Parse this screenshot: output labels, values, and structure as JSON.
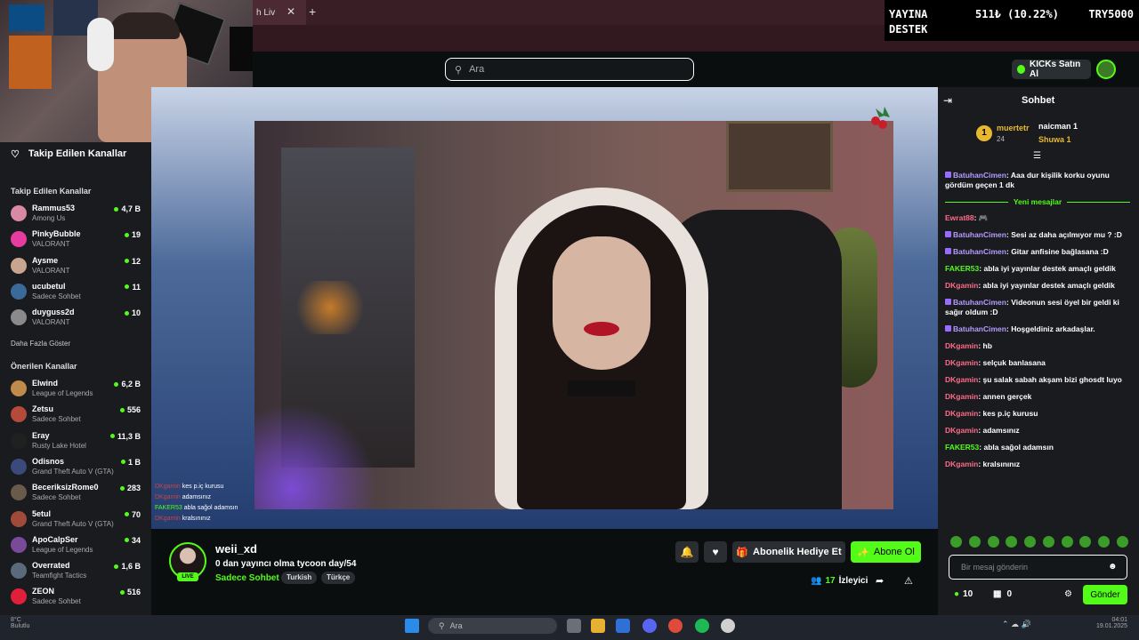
{
  "browser": {
    "tab_title": "h Liv",
    "tab_close": "✕",
    "new_tab": "+"
  },
  "donation_overlay": {
    "line1": "YAYINA",
    "line2": "DESTEK",
    "amount": "511₺ (10.22%)",
    "goal": "TRY5000"
  },
  "header": {
    "search_placeholder": "Ara",
    "kicks_button": "KICKs Satın Al"
  },
  "sidebar": {
    "heading": "Takip Edilen Kanallar",
    "followed_title": "Takip Edilen Kanallar",
    "followed": [
      {
        "name": "Rammus53",
        "category": "Among Us",
        "viewers": "4,7 B",
        "color": "#d88aa3"
      },
      {
        "name": "PinkyBubble",
        "category": "VALORANT",
        "viewers": "19",
        "color": "#e63ca0"
      },
      {
        "name": "Aysme",
        "category": "VALORANT",
        "viewers": "12",
        "color": "#c9a58f"
      },
      {
        "name": "ucubetul",
        "category": "Sadece Sohbet",
        "viewers": "11",
        "color": "#3a6a9a"
      },
      {
        "name": "duyguss2d",
        "category": "VALORANT",
        "viewers": "10",
        "color": "#8a8a8a"
      }
    ],
    "show_more": "Daha Fazla Göster",
    "recommended_title": "Önerilen Kanallar",
    "recommended": [
      {
        "name": "Elwind",
        "category": "League of Legends",
        "viewers": "6,2 B",
        "color": "#c08a4a"
      },
      {
        "name": "Zetsu",
        "category": "Sadece Sohbet",
        "viewers": "556",
        "color": "#b54a3a"
      },
      {
        "name": "Eray",
        "category": "Rusty Lake Hotel",
        "viewers": "11,3 B",
        "color": "#202020"
      },
      {
        "name": "Odisnos",
        "category": "Grand Theft Auto V (GTA)",
        "viewers": "1 B",
        "color": "#3a4a7a"
      },
      {
        "name": "BeceriksizRome0",
        "category": "Sadece Sohbet",
        "viewers": "283",
        "color": "#6a5a4a"
      },
      {
        "name": "5etul",
        "category": "Grand Theft Auto V (GTA)",
        "viewers": "70",
        "color": "#a04a3a"
      },
      {
        "name": "ApoCalpSer",
        "category": "League of Legends",
        "viewers": "34",
        "color": "#7a4a9a"
      },
      {
        "name": "Overrated",
        "category": "Teamfight Tactics",
        "viewers": "1,6 B",
        "color": "#5a6a7a"
      },
      {
        "name": "ZEON",
        "category": "Sadece Sohbet",
        "viewers": "516",
        "color": "#e0203a"
      }
    ]
  },
  "stream_overlay_chat": [
    {
      "user": "DKgamin",
      "text": "kes p.iç kurusu",
      "cls": "u1"
    },
    {
      "user": "DKgamin",
      "text": "adamsınız",
      "cls": "u1"
    },
    {
      "user": "FAKER53",
      "text": "abla sağol adamsın",
      "cls": "u2"
    },
    {
      "user": "DKgamin",
      "text": "kralsınınız",
      "cls": "u1"
    }
  ],
  "stream": {
    "channel": "weii_xd",
    "title": "0 dan yayıncı olma tycoon day/54",
    "category": "Sadece Sohbet",
    "tags": [
      "Turkish",
      "Türkçe"
    ],
    "live": "LIVE",
    "gift_label": "Abonelik Hediye Et",
    "subscribe_label": "Abone Ol",
    "viewers": "17",
    "viewers_label": "İzleyici"
  },
  "chat": {
    "title": "Sohbet",
    "leader": {
      "rank": "1",
      "name": "muertetr",
      "count": "24"
    },
    "leader2": "naicman 1",
    "leader3": "Shuwa 1",
    "new_messages": "Yeni mesajlar",
    "messages_before": [
      {
        "user": "BatuhanCimen",
        "text": "Aaa dur kişilik korku oyunu gördüm geçen 1 dk",
        "cls": "u-purple",
        "badge": true
      }
    ],
    "messages_after": [
      {
        "user": "Ewrat88",
        "text": "🎮",
        "cls": "u-red",
        "badge": false
      },
      {
        "user": "BatuhanCimen",
        "text": "Sesi az daha açılmıyor mu ? :D",
        "cls": "u-purple",
        "badge": true
      },
      {
        "user": "BatuhanCimen",
        "text": "Gitar anfisine bağlasana :D",
        "cls": "u-purple",
        "badge": true
      },
      {
        "user": "FAKER53",
        "text": "abla iyi yayınlar destek amaçlı geldik",
        "cls": "u-green",
        "badge": false
      },
      {
        "user": "DKgamin",
        "text": "abla iyi yayınlar destek amaçlı geldik",
        "cls": "u-red",
        "badge": false
      },
      {
        "user": "BatuhanCimen",
        "text": "Videonun sesi öyel bir geldi ki sağır oldum :D",
        "cls": "u-purple",
        "badge": true
      },
      {
        "user": "BatuhanCimen",
        "text": "Hoşgeldiniz arkadaşlar.",
        "cls": "u-purple",
        "badge": true
      },
      {
        "user": "DKgamin",
        "text": "hb",
        "cls": "u-red",
        "badge": false
      },
      {
        "user": "DKgamin",
        "text": "selçuk banlasana",
        "cls": "u-red",
        "badge": false
      },
      {
        "user": "DKgamin",
        "text": "şu salak sabah akşam bizi ghosdt luyo",
        "cls": "u-red",
        "badge": false
      },
      {
        "user": "DKgamin",
        "text": "annen gerçek",
        "cls": "u-red",
        "badge": false
      },
      {
        "user": "DKgamin",
        "text": "kes p.iç kurusu",
        "cls": "u-red",
        "badge": false
      },
      {
        "user": "DKgamin",
        "text": "adamsınız",
        "cls": "u-red",
        "badge": false
      },
      {
        "user": "FAKER53",
        "text": "abla sağol adamsın",
        "cls": "u-green",
        "badge": false
      },
      {
        "user": "DKgamin",
        "text": "kralsınınız",
        "cls": "u-red",
        "badge": false
      }
    ],
    "input_placeholder": "Bir mesaj gönderin",
    "points": "10",
    "drops": "0",
    "send_label": "Gönder"
  },
  "taskbar": {
    "search_placeholder": "Ara",
    "weather": "8°C",
    "weather_sub": "Bulutlu",
    "time": "04:01",
    "date": "19.01.2025"
  },
  "colors": {
    "kick_green": "#53fc18",
    "panel_bg": "#191b1f",
    "page_bg": "#0b0e0f"
  }
}
